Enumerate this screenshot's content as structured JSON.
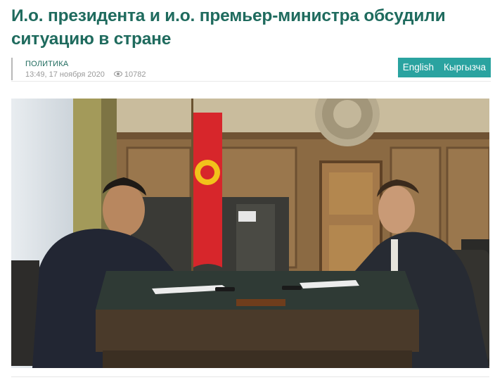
{
  "article": {
    "title": "И.о. президента и и.о. премьер-министра обсудили ситуацию в стране",
    "category": "ПОЛИТИКА",
    "datetime": "13:49, 17 ноября 2020",
    "views": "10782"
  },
  "languages": [
    {
      "label": "English"
    },
    {
      "label": "Кыргызча"
    }
  ],
  "colors": {
    "title": "#1f6b5e",
    "lang_button_bg": "#2aa3a0",
    "meta_text": "#9a9a9a"
  },
  "icons": {
    "views": "eye-icon"
  }
}
